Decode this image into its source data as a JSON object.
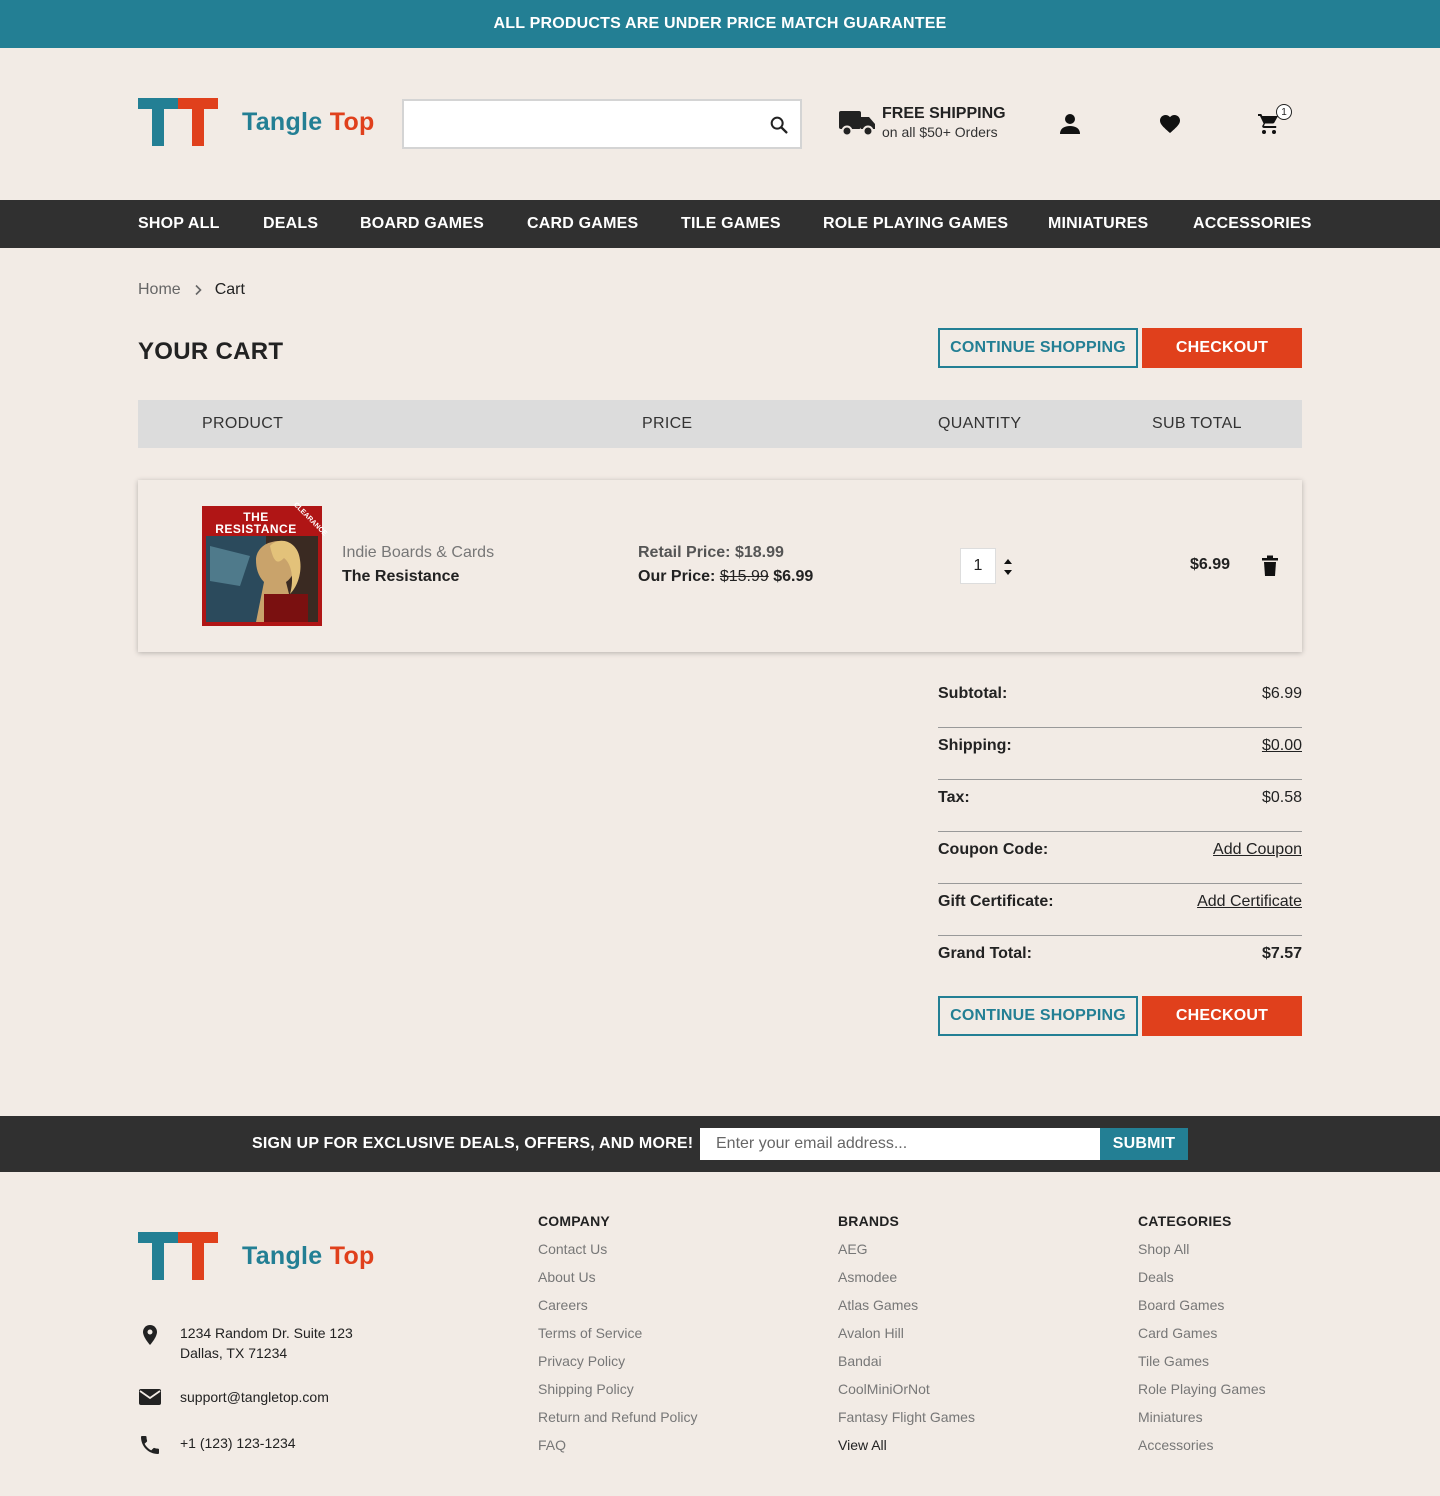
{
  "announcement": "ALL PRODUCTS ARE UNDER PRICE MATCH GUARANTEE",
  "brand": {
    "word1": "Tangle",
    "word2": "Top"
  },
  "search": {
    "placeholder": ""
  },
  "shipping": {
    "title": "FREE SHIPPING",
    "subtitle": "on all $50+ Orders"
  },
  "cart_count": "1",
  "nav": [
    "SHOP ALL",
    "DEALS",
    "BOARD GAMES",
    "CARD GAMES",
    "TILE GAMES",
    "ROLE PLAYING GAMES",
    "MINIATURES",
    "ACCESSORIES"
  ],
  "breadcrumb": {
    "home": "Home",
    "current": "Cart"
  },
  "page_title": "YOUR CART",
  "buttons": {
    "continue": "CONTINUE SHOPPING",
    "checkout": "CHECKOUT",
    "submit": "SUBMIT"
  },
  "table_headers": {
    "product": "PRODUCT",
    "price": "PRICE",
    "quantity": "QUANTITY",
    "subtotal": "SUB TOTAL"
  },
  "item": {
    "brand": "Indie Boards & Cards",
    "name": "The Resistance",
    "image_title": "THE RESISTANCE",
    "image_badge": "CLEARANCE",
    "retail_label": "Retail Price:",
    "retail_price": "$18.99",
    "our_label": "Our Price:",
    "old_price": "$15.99",
    "our_price": "$6.99",
    "quantity": "1",
    "subtotal": "$6.99"
  },
  "totals": [
    {
      "label": "Subtotal:",
      "value": "$6.99"
    },
    {
      "label": "Shipping:",
      "value": "$0.00"
    },
    {
      "label": "Tax:",
      "value": "$0.58"
    },
    {
      "label": "Coupon Code:",
      "value": "Add Coupon"
    },
    {
      "label": "Gift Certificate:",
      "value": "Add Certificate"
    },
    {
      "label": "Grand Total:",
      "value": "$7.57"
    }
  ],
  "signup": {
    "text": "SIGN UP FOR EXCLUSIVE DEALS, OFFERS, AND MORE!",
    "placeholder": "Enter your email address..."
  },
  "contact": {
    "address_line1": "1234 Random Dr. Suite 123",
    "address_line2": "Dallas, TX 71234",
    "email": "support@tangletop.com",
    "phone": "+1 (123) 123-1234"
  },
  "footer": {
    "company": {
      "title": "COMPANY",
      "links": [
        "Contact Us",
        "About Us",
        "Careers",
        "Terms of Service",
        "Privacy Policy",
        "Shipping Policy",
        "Return and Refund Policy",
        "FAQ"
      ]
    },
    "brands": {
      "title": "BRANDS",
      "links": [
        "AEG",
        "Asmodee",
        "Atlas Games",
        "Avalon Hill",
        "Bandai",
        "CoolMiniOrNot",
        "Fantasy Flight Games",
        "View All"
      ]
    },
    "categories": {
      "title": "CATEGORIES",
      "links": [
        "Shop All",
        "Deals",
        "Board Games",
        "Card Games",
        "Tile Games",
        "Role Playing Games",
        "Miniatures",
        "Accessories"
      ]
    }
  },
  "colors": {
    "teal": "#237f94",
    "orange": "#e0401c",
    "dark": "#303030",
    "background": "#f2ebe5"
  }
}
